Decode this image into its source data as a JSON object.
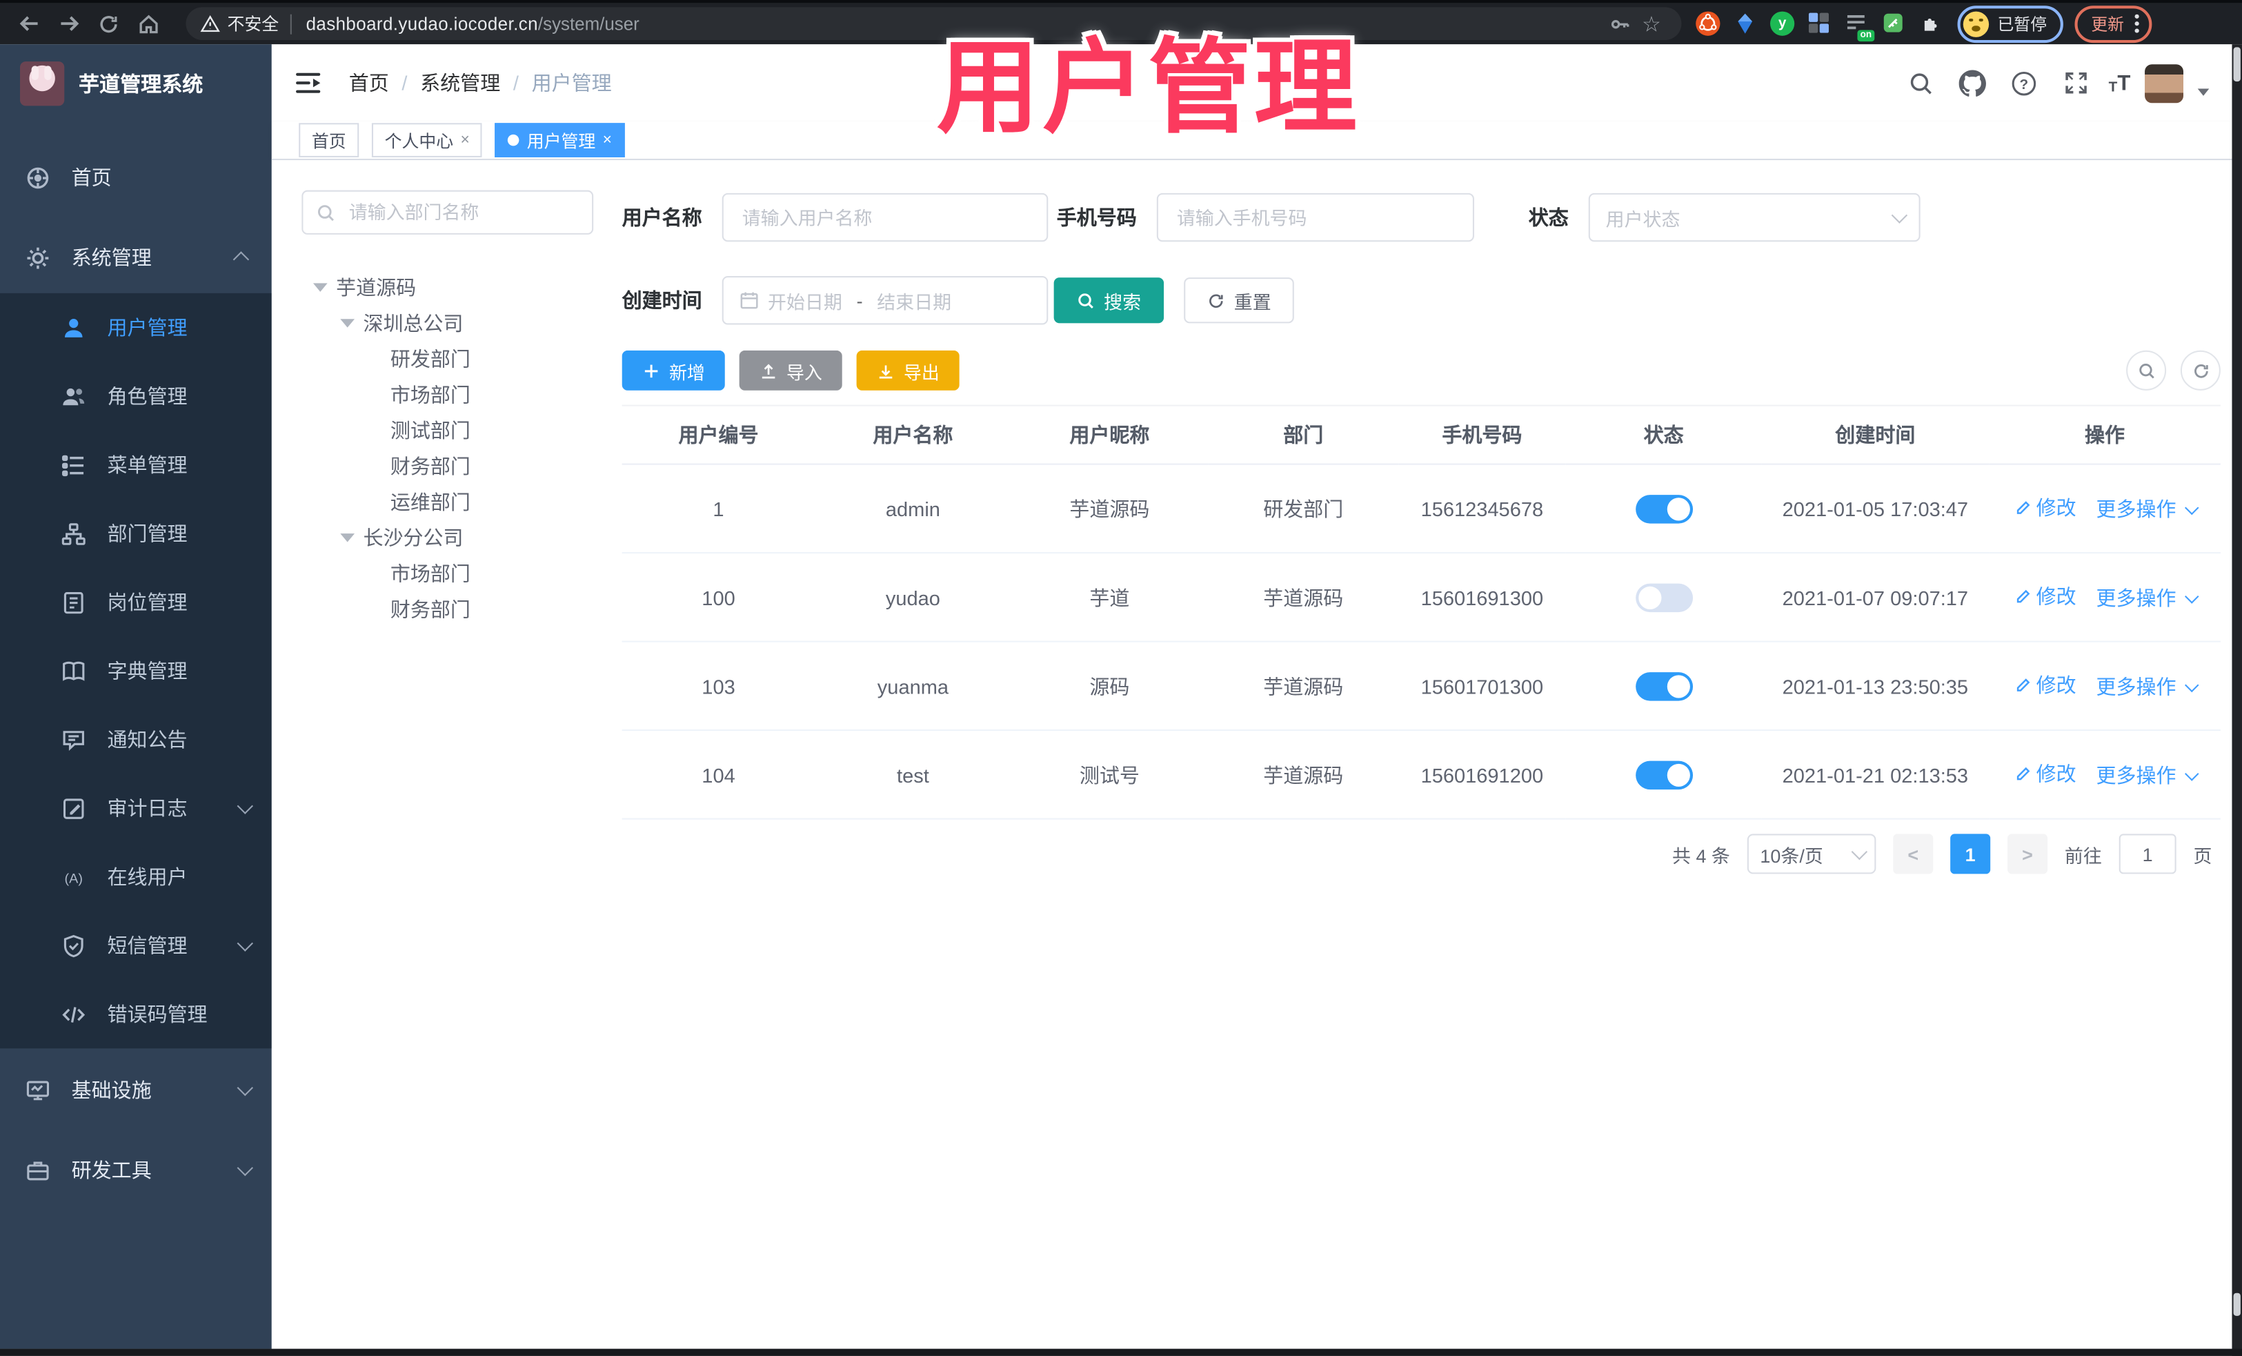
{
  "overlay": {
    "title": "用户管理"
  },
  "browser": {
    "security_label": "不安全",
    "url_host": "dashboard.yudao.iocoder.cn",
    "url_path": "/system/user",
    "extension_badge": "on",
    "profile_status": "已暂停",
    "update_label": "更新"
  },
  "glyphs": {
    "close": "×",
    "breadcrumb_sep": "/",
    "star": "☆"
  },
  "header": {
    "logo_title": "芋道管理系统",
    "breadcrumb": [
      "首页",
      "系统管理",
      "用户管理"
    ]
  },
  "tabs": [
    {
      "label": "首页"
    },
    {
      "label": "个人中心"
    },
    {
      "label": "用户管理"
    }
  ],
  "sidebar": {
    "items": [
      {
        "label": "首页"
      },
      {
        "label": "系统管理"
      },
      {
        "label": "用户管理"
      },
      {
        "label": "角色管理"
      },
      {
        "label": "菜单管理"
      },
      {
        "label": "部门管理"
      },
      {
        "label": "岗位管理"
      },
      {
        "label": "字典管理"
      },
      {
        "label": "通知公告"
      },
      {
        "label": "审计日志"
      },
      {
        "label": "在线用户"
      },
      {
        "label": "短信管理"
      },
      {
        "label": "错误码管理"
      },
      {
        "label": "基础设施"
      },
      {
        "label": "研发工具"
      }
    ]
  },
  "tree": {
    "search_placeholder": "请输入部门名称",
    "nodes": [
      {
        "label": "芋道源码"
      },
      {
        "label": "深圳总公司"
      },
      {
        "label": "研发部门"
      },
      {
        "label": "市场部门"
      },
      {
        "label": "测试部门"
      },
      {
        "label": "财务部门"
      },
      {
        "label": "运维部门"
      },
      {
        "label": "长沙分公司"
      },
      {
        "label": "市场部门"
      },
      {
        "label": "财务部门"
      }
    ]
  },
  "filters": {
    "username_label": "用户名称",
    "username_placeholder": "请输入用户名称",
    "mobile_label": "手机号码",
    "mobile_placeholder": "请输入手机号码",
    "status_label": "状态",
    "status_placeholder": "用户状态",
    "create_time_label": "创建时间",
    "start_placeholder": "开始日期",
    "range_separator": "-",
    "end_placeholder": "结束日期",
    "search_label": "搜索",
    "reset_label": "重置"
  },
  "toolbar": {
    "add_label": "新增",
    "import_label": "导入",
    "export_label": "导出"
  },
  "table": {
    "headers": [
      "用户编号",
      "用户名称",
      "用户昵称",
      "部门",
      "手机号码",
      "状态",
      "创建时间",
      "操作"
    ],
    "edit_label": "修改",
    "more_label": "更多操作",
    "rows": [
      {
        "id": "1",
        "username": "admin",
        "nickname": "芋道源码",
        "dept": "研发部门",
        "mobile": "15612345678",
        "status": "on",
        "created": "2021-01-05 17:03:47"
      },
      {
        "id": "100",
        "username": "yudao",
        "nickname": "芋道",
        "dept": "芋道源码",
        "mobile": "15601691300",
        "status": "off",
        "created": "2021-01-07 09:07:17"
      },
      {
        "id": "103",
        "username": "yuanma",
        "nickname": "源码",
        "dept": "芋道源码",
        "mobile": "15601701300",
        "status": "on",
        "created": "2021-01-13 23:50:35"
      },
      {
        "id": "104",
        "username": "test",
        "nickname": "测试号",
        "dept": "芋道源码",
        "mobile": "15601691200",
        "status": "on",
        "created": "2021-01-21 02:13:53"
      }
    ]
  },
  "pagination": {
    "total_label": "共 4 条",
    "page_size_label": "10条/页",
    "prev_glyph": "<",
    "current_page": "1",
    "next_glyph": ">",
    "goto_label": "前往",
    "goto_value": "1",
    "page_unit": "页"
  },
  "colors": {
    "primary": "#409eff",
    "search_teal": "#17a394",
    "export_yellow": "#f2b007",
    "import_gray": "#909399",
    "sidebar_bg": "#304156",
    "submenu_bg": "#1f2d3d",
    "overlay_pink": "#fb3a5e"
  }
}
